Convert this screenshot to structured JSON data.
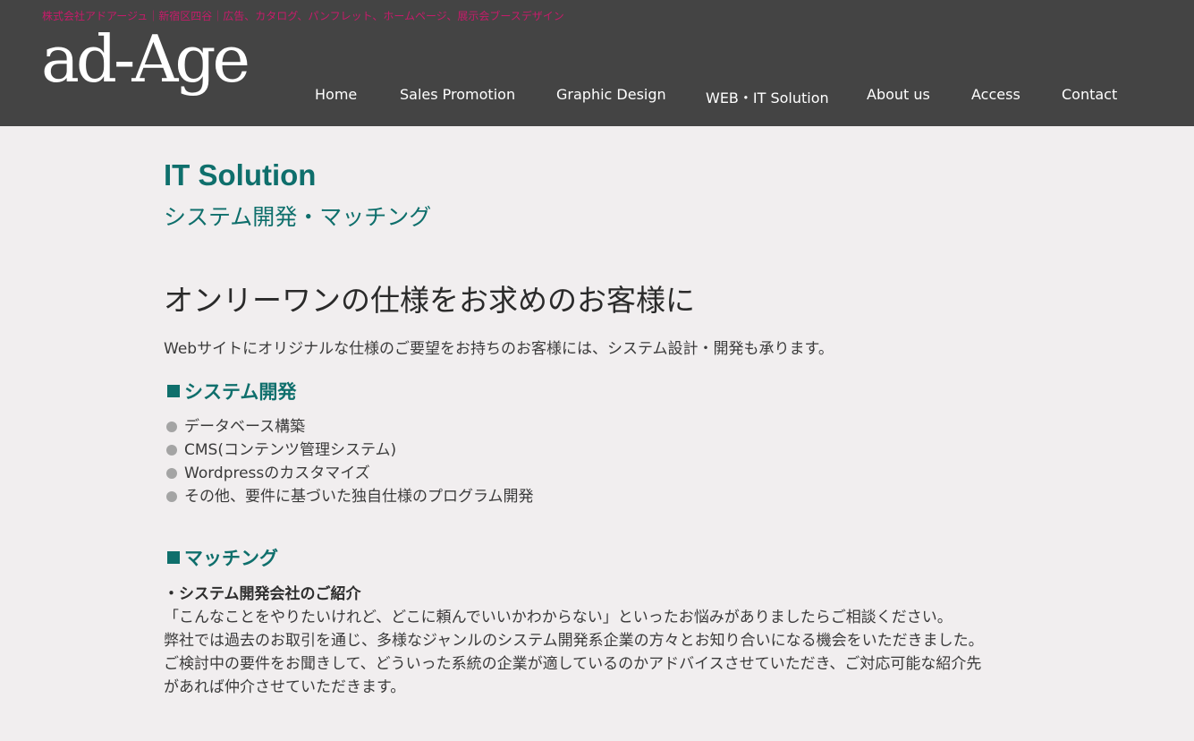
{
  "header": {
    "tagline": "株式会社アドアージュ｜新宿区四谷｜広告、カタログ、パンフレット、ホームページ、展示会ブースデザイン",
    "logo_text": "ad-Age",
    "background_color": "#444444",
    "tagline_color": "#c71b6a"
  },
  "nav": {
    "items": [
      {
        "label": "Home"
      },
      {
        "label": "Sales Promotion"
      },
      {
        "label": "Graphic Design"
      },
      {
        "label": "WEB・IT Solution"
      },
      {
        "label": "About us"
      },
      {
        "label": "Access"
      },
      {
        "label": "Contact"
      }
    ]
  },
  "main": {
    "title": "IT Solution",
    "subtitle": "システム開発・マッチング",
    "headline": "オンリーワンの仕様をお求めのお客様に",
    "intro": "Webサイトにオリジナルな仕様のご要望をお持ちのお客様には、システム設計・開発も承ります。",
    "accent_color": "#0f6f6c",
    "sections": [
      {
        "heading": "システム開発",
        "items": [
          "データベース構築",
          "CMS(コンテンツ管理システム)",
          "Wordpressのカスタマイズ",
          "その他、要件に基づいた独自仕様のプログラム開発"
        ]
      },
      {
        "heading": "マッチング",
        "subheading": "・システム開発会社のご紹介",
        "lines": [
          "「こんなことをやりたいけれど、どこに頼んでいいかわからない」といったお悩みがありましたらご相談ください。",
          "弊社では過去のお取引を通じ、多様なジャンルのシステム開発系企業の方々とお知り合いになる機会をいただきました。",
          "ご検討中の要件をお聞きして、どういった系統の企業が適しているのかアドバイスさせていただき、ご対応可能な紹介先",
          "があれば仲介させていただきます。"
        ]
      }
    ]
  }
}
